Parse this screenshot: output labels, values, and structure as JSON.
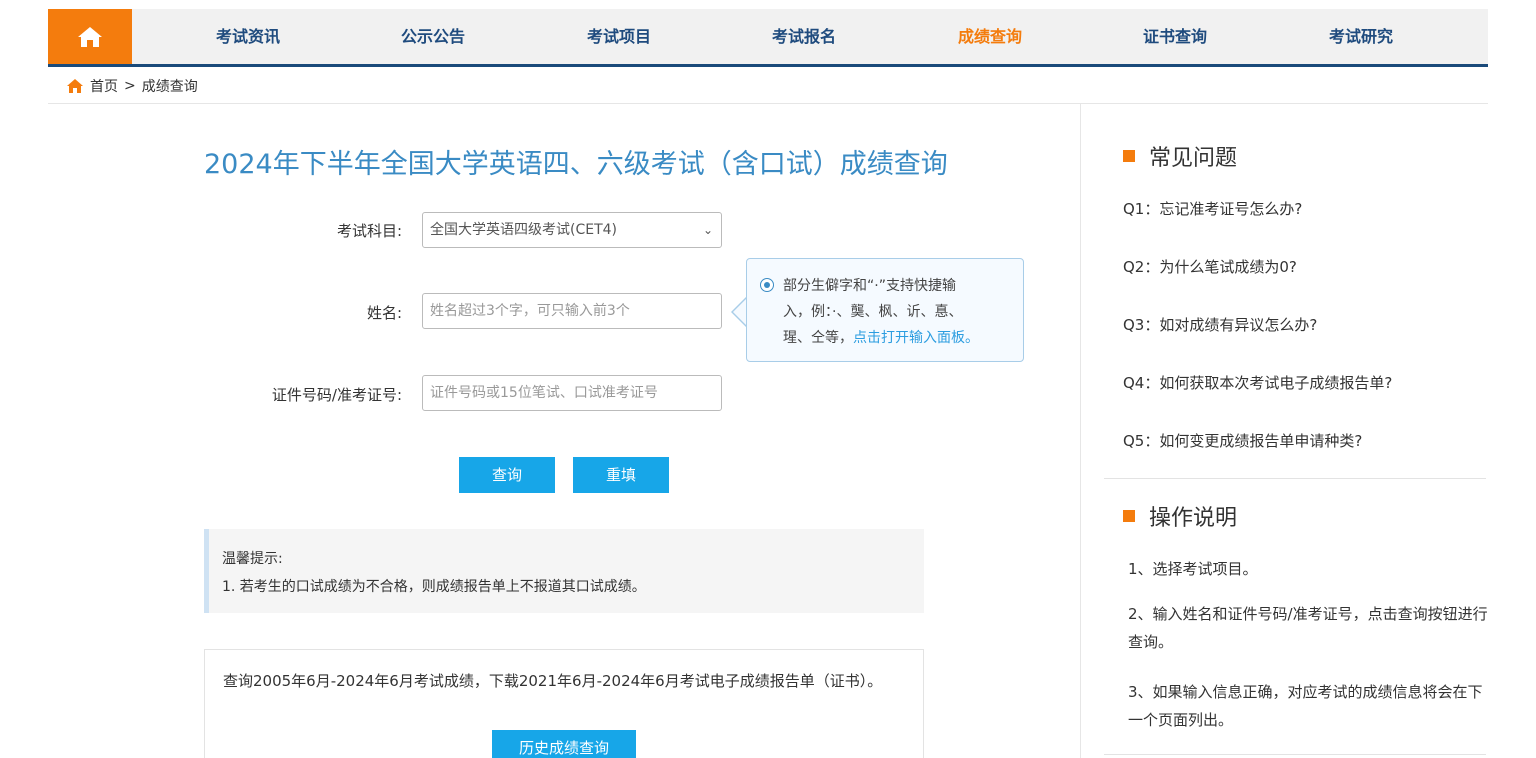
{
  "nav": {
    "home_icon": "home-icon",
    "items": [
      {
        "label": "考试资讯"
      },
      {
        "label": "公示公告"
      },
      {
        "label": "考试项目"
      },
      {
        "label": "考试报名"
      },
      {
        "label": "成绩查询",
        "active": true
      },
      {
        "label": "证书查询"
      },
      {
        "label": "考试研究"
      }
    ],
    "accent_color": "#f47c0d",
    "text_color": "#1f4b7e"
  },
  "breadcrumb": {
    "home": "首页",
    "separator": ">",
    "current": "成绩查询"
  },
  "main": {
    "title": "2024年下半年全国大学英语四、六级考试（含口试）成绩查询",
    "form": {
      "subject_label": "考试科目:",
      "subject_value": "全国大学英语四级考试(CET4)",
      "name_label": "姓名:",
      "name_placeholder": "姓名超过3个字，可只输入前3个",
      "id_label": "证件号码/准考证号:",
      "id_placeholder": "证件号码或15位笔试、口试准考证号"
    },
    "tip": {
      "line1": "部分生僻字和“·”支持快捷输",
      "line2": "入，例：·、龑、枫、䜣、惪、",
      "line3_prefix": "瑆、仝等，",
      "line3_link": "点击打开输入面板。"
    },
    "buttons": {
      "query": "查询",
      "reset": "重填"
    },
    "notice": {
      "heading": "温馨提示:",
      "line1": "1. 若考生的口试成绩为不合格，则成绩报告单上不报道其口试成绩。"
    },
    "history": {
      "text": "查询2005年6月-2024年6月考试成绩，下载2021年6月-2024年6月考试电子成绩报告单（证书）。",
      "button": "历史成绩查询"
    }
  },
  "sidebar": {
    "faq_title": "常见问题",
    "faqs": [
      "Q1：忘记准考证号怎么办?",
      "Q2：为什么笔试成绩为0?",
      "Q3：如对成绩有异议怎么办?",
      "Q4：如何获取本次考试电子成绩报告单?",
      "Q5：如何变更成绩报告单申请种类?"
    ],
    "ops_title": "操作说明",
    "ops": [
      "1、选择考试项目。",
      "2、输入姓名和证件号码/准考证号，点击查询按钮进行查询。",
      "3、如果输入信息正确，对应考试的成绩信息将会在下一个页面列出。"
    ]
  }
}
